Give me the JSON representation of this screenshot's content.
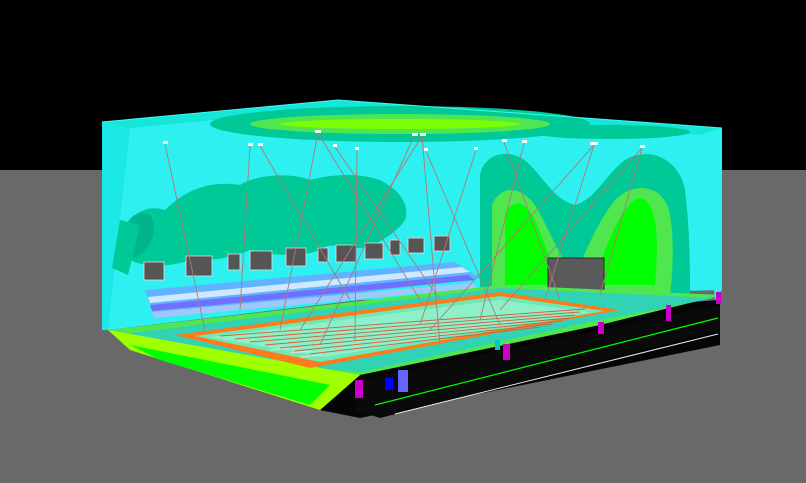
{
  "view": {
    "background_color": "#000000",
    "floor_color": "#696969",
    "illuminance_palette": [
      "#00ffff",
      "#00d2a0",
      "#00c896",
      "#50e650",
      "#00ff00",
      "#a0ff00",
      "#ff6400",
      "#c800c8",
      "#0000ff"
    ]
  }
}
